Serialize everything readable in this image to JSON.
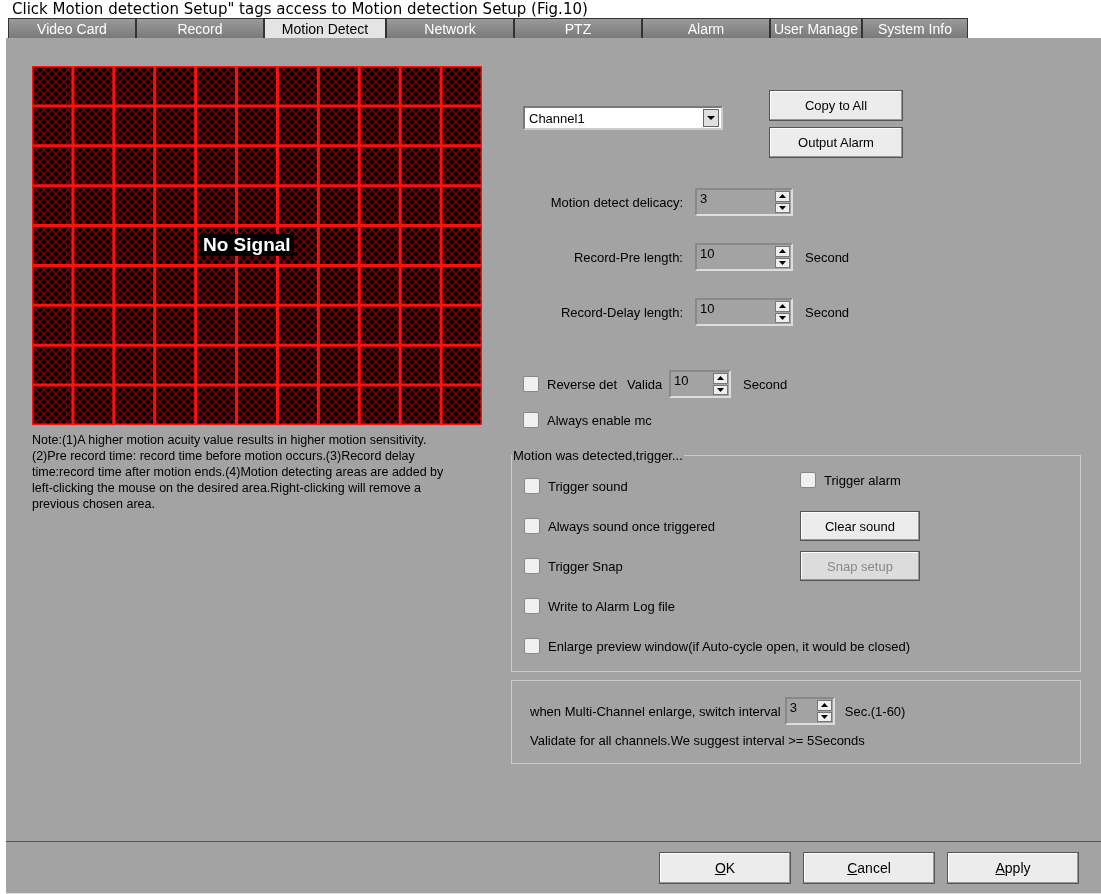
{
  "caption": "Click Motion detection Setup\" tags access to Motion detection Setup (Fig.10)",
  "tabs": [
    {
      "label": "Video Card",
      "selected": false
    },
    {
      "label": "Record",
      "selected": false
    },
    {
      "label": "Motion Detect",
      "selected": true
    },
    {
      "label": "Network",
      "selected": false
    },
    {
      "label": "PTZ",
      "selected": false
    },
    {
      "label": "Alarm",
      "selected": false
    },
    {
      "label": "User Manage",
      "selected": false
    },
    {
      "label": "System Info",
      "selected": false
    }
  ],
  "preview": {
    "overlay": "No Signal"
  },
  "note": "Note:(1)A higher motion acuity value results in higher motion sensitivity.(2)Pre record time: record time before motion occurs.(3)Record delay time:record time after motion ends.(4)Motion detecting areas are added by left-clicking the mouse on the desired area.Right-clicking will remove a previous chosen area.",
  "channel": {
    "value": "Channel1"
  },
  "top_buttons": [
    {
      "label": "Copy to All"
    },
    {
      "label": "Output Alarm"
    }
  ],
  "spin_rows": [
    {
      "label": "Motion detect delicacy:",
      "value": "3"
    },
    {
      "label": "Record-Pre length:",
      "value": "10",
      "unit": "Second"
    },
    {
      "label": "Record-Delay length:",
      "value": "10",
      "unit": "Second"
    }
  ],
  "reverse": {
    "label": "Reverse det",
    "checked": false,
    "valid_label": "Valida",
    "value": "10",
    "unit": "Second"
  },
  "always_enable": {
    "label": "Always enable mc",
    "checked": false
  },
  "trigger_group": {
    "title": "Motion was detected,trigger...",
    "items": [
      {
        "kind": "pair",
        "label": "Trigger sound",
        "checked": false,
        "right": {
          "kind": "checkbox",
          "label": "Trigger alarm",
          "checked": false
        }
      },
      {
        "kind": "pair",
        "label": "Always sound once triggered",
        "checked": false,
        "right": {
          "kind": "button",
          "label": "Clear sound",
          "disabled": false
        }
      },
      {
        "kind": "pair",
        "label": "Trigger Snap",
        "checked": false,
        "right": {
          "kind": "button",
          "label": "Snap setup",
          "disabled": true
        }
      },
      {
        "kind": "single",
        "label": "Write to Alarm Log file",
        "checked": false
      },
      {
        "kind": "single",
        "label": "Enlarge preview window(if Auto-cycle open, it would be closed)",
        "checked": false
      }
    ]
  },
  "interval": {
    "label": "when Multi-Channel enlarge, switch interval",
    "value": "3",
    "range": "Sec.(1-60)",
    "hint": "Validate for all channels.We suggest interval >= 5Seconds"
  },
  "footer_buttons": [
    {
      "label": "OK"
    },
    {
      "label": "Cancel"
    },
    {
      "label": "Apply"
    }
  ]
}
